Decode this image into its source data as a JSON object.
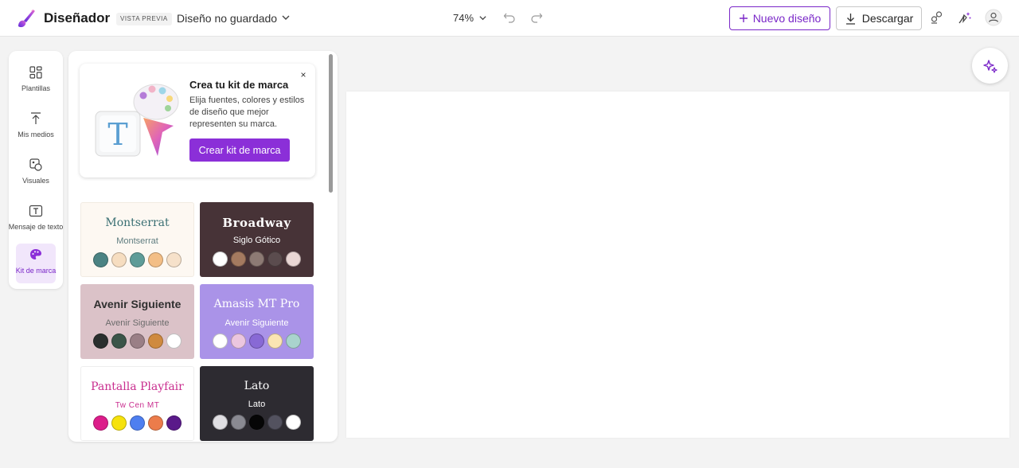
{
  "header": {
    "app_name": "Diseñador",
    "preview_badge": "VISTA PREVIA",
    "document_title": "Diseño no guardado",
    "zoom_level": "74%",
    "new_design_label": "Nuevo diseño",
    "download_label": "Descargar",
    "icons": [
      "designer-logo-icon",
      "chevron-down-icon",
      "undo-icon",
      "redo-icon",
      "plus-icon",
      "download-icon",
      "share-icon",
      "magic-icon",
      "account-icon"
    ]
  },
  "sidebar": {
    "items": [
      {
        "label": "Plantillas",
        "icon": "templates-icon",
        "active": false
      },
      {
        "label": "Mis medios",
        "icon": "upload-icon",
        "active": false
      },
      {
        "label": "Visuales",
        "icon": "visuals-icon",
        "active": false
      },
      {
        "label": "Mensaje de texto",
        "icon": "text-icon",
        "active": false
      },
      {
        "label": "Kit de marca",
        "icon": "palette-icon",
        "active": true
      }
    ]
  },
  "promo": {
    "title": "Crea tu kit de marca",
    "body": "Elija fuentes, colores y estilos de diseño que mejor representen su marca.",
    "button_label": "Crear kit de marca",
    "close_label": "×"
  },
  "kits": [
    {
      "heading": "Montserrat",
      "subheading": "Montserrat",
      "background": "#fdf8f2",
      "text_color": "#3a6f73",
      "sub_color": "#5f7d80",
      "swatches": [
        "#4b8383",
        "#f6ddc0",
        "#5e9c98",
        "#f3be86",
        "#f6e1ca"
      ]
    },
    {
      "heading": "Broadway",
      "subheading": "Siglo Gótico",
      "background": "#473337",
      "text_color": "#ffffff",
      "sub_color": "#ffffff",
      "swatches": [
        "#ffffff",
        "#a47a60",
        "#8d7a74",
        "#5b4c4e",
        "#e9d6d4"
      ]
    },
    {
      "heading": "Avenir Siguiente",
      "subheading": "Avenir Siguiente",
      "background": "#dbc2c8",
      "text_color": "#2f2f2f",
      "sub_color": "#6b6b6b",
      "swatches": [
        "#2a2f2e",
        "#3b5549",
        "#9a7f86",
        "#cf8a3f",
        "#ffffff"
      ]
    },
    {
      "heading": "Amasis MT Pro",
      "subheading": "Avenir Siguiente",
      "background": "#aa93e8",
      "text_color": "#ffffff",
      "sub_color": "#ffffff",
      "swatches": [
        "#ffffff",
        "#ebc6df",
        "#8869d5",
        "#fbe5b3",
        "#a9d3cd"
      ]
    },
    {
      "heading": "Pantalla Playfair",
      "subheading": "Tw Cen MT",
      "background": "#ffffff",
      "text_color": "#c92e8f",
      "sub_color": "#c92e8f",
      "swatches": [
        "#dc1d8a",
        "#f6e20c",
        "#4e7ff0",
        "#ec7c4b",
        "#5a1a8a"
      ]
    },
    {
      "heading": "Lato",
      "subheading": "Lato",
      "background": "#2d2b31",
      "text_color": "#ffffff",
      "sub_color": "#ffffff",
      "swatches": [
        "#e0dfe3",
        "#8a8a92",
        "#060606",
        "#53525f",
        "#ffffff"
      ]
    }
  ],
  "colors": {
    "accent": "#7a27c8",
    "accent_button": "#8b2fd8",
    "canvas_background": "#ffffff",
    "workspace_background": "#f3f3f3"
  }
}
